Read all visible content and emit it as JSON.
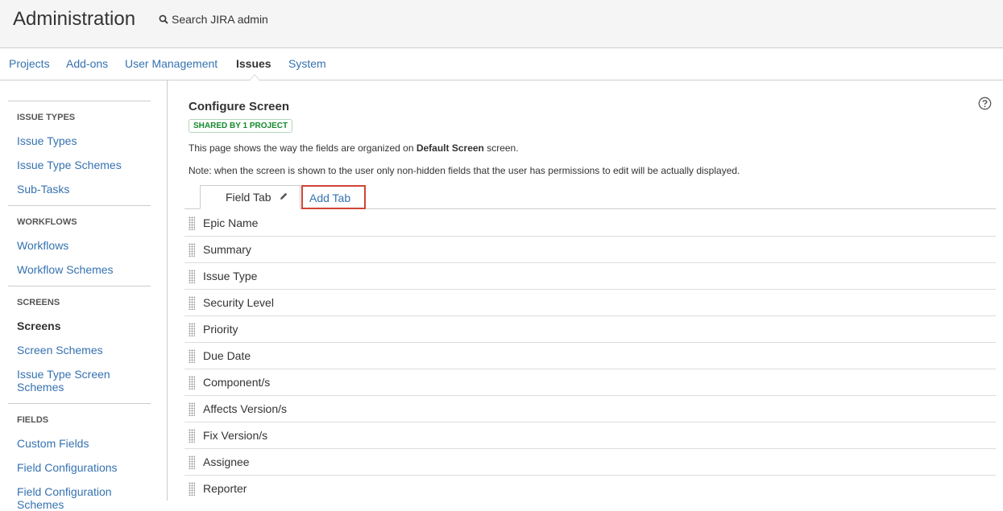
{
  "header": {
    "title": "Administration",
    "search_label": "Search JIRA admin"
  },
  "nav": {
    "items": [
      {
        "label": "Projects"
      },
      {
        "label": "Add-ons"
      },
      {
        "label": "User Management"
      },
      {
        "label": "Issues"
      },
      {
        "label": "System"
      }
    ],
    "active": "Issues"
  },
  "sidebar": {
    "sections": [
      {
        "heading": "ISSUE TYPES",
        "links": [
          "Issue Types",
          "Issue Type Schemes",
          "Sub-Tasks"
        ]
      },
      {
        "heading": "WORKFLOWS",
        "links": [
          "Workflows",
          "Workflow Schemes"
        ]
      },
      {
        "heading": "SCREENS",
        "links": [
          "Screens",
          "Screen Schemes",
          "Issue Type Screen Schemes"
        ]
      },
      {
        "heading": "FIELDS",
        "links": [
          "Custom Fields",
          "Field Configurations",
          "Field Configuration Schemes"
        ]
      }
    ],
    "active_link": "Screens"
  },
  "main": {
    "title": "Configure Screen",
    "badge": "SHARED BY 1 PROJECT",
    "desc_prefix": "This page shows the way the fields are organized on ",
    "desc_bold": "Default Screen",
    "desc_suffix": " screen.",
    "note": "Note: when the screen is shown to the user only non-hidden fields that the user has permissions to edit will be actually displayed.",
    "tabs": {
      "field_tab": "Field Tab",
      "add_tab": "Add Tab"
    },
    "fields": [
      "Epic Name",
      "Summary",
      "Issue Type",
      "Security Level",
      "Priority",
      "Due Date",
      "Component/s",
      "Affects Version/s",
      "Fix Version/s",
      "Assignee",
      "Reporter"
    ]
  },
  "colors": {
    "link": "#3572b0",
    "highlight_border": "#d04437",
    "badge_green": "#14892c"
  },
  "icons": {
    "search": "search-icon",
    "help": "help-icon",
    "edit": "pencil-icon",
    "drag": "drag-handle-icon"
  }
}
